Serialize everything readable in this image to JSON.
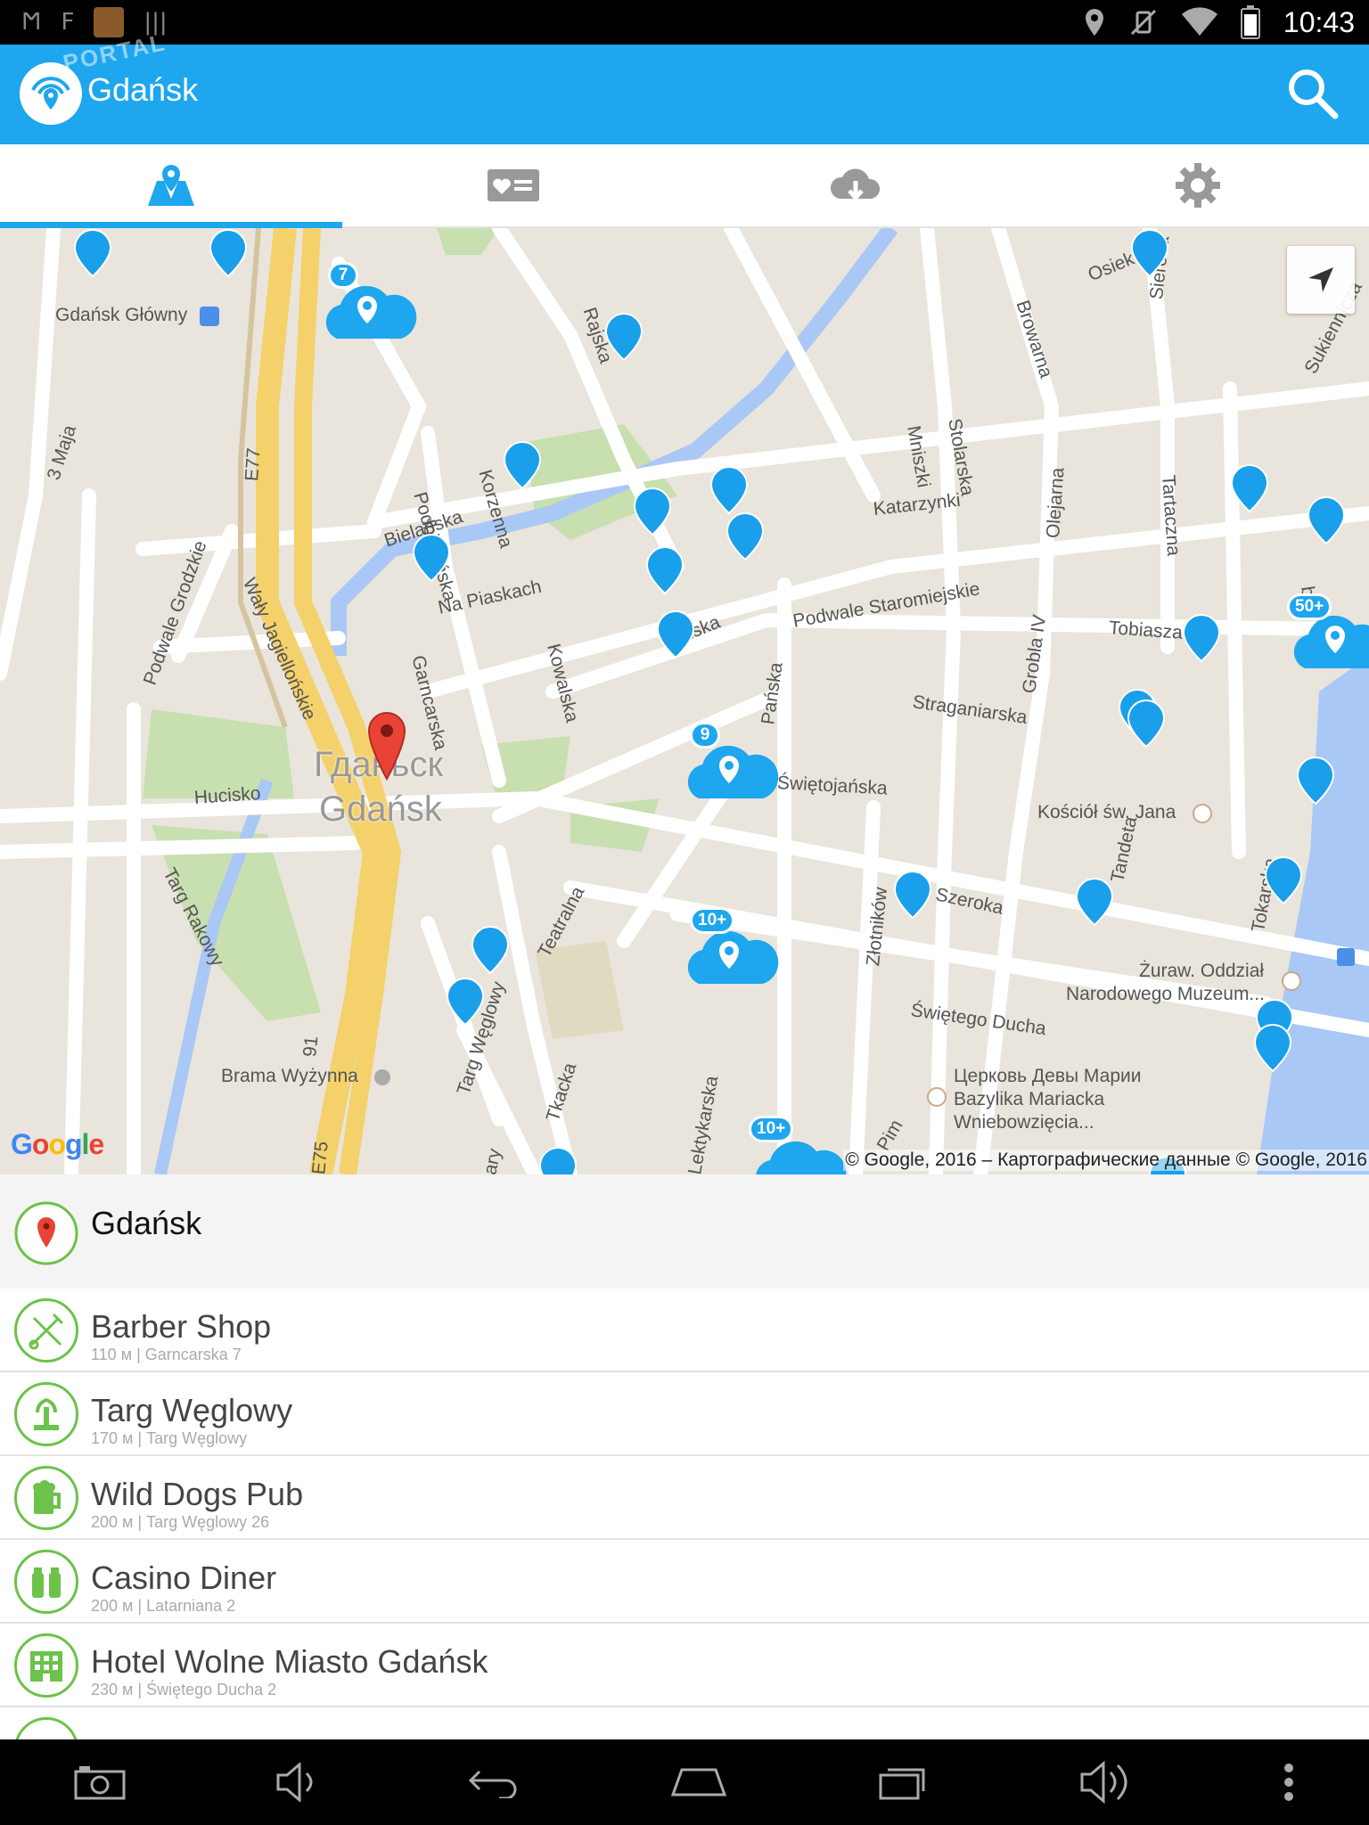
{
  "status_bar": {
    "time": "10:43",
    "left_icons": [
      "notification-m",
      "notification-f",
      "game-thumbnail",
      "barcode"
    ],
    "right_icons": [
      "location-icon",
      "vibrate-icon",
      "wifi-icon",
      "battery-icon"
    ]
  },
  "app_bar": {
    "title": "Gdańsk",
    "watermark": "PORTAL",
    "logo_icon": "wifi-pin-logo",
    "action_icon": "search-icon",
    "color": "#1ea6ee"
  },
  "tabs": [
    {
      "icon": "map-icon",
      "active": true
    },
    {
      "icon": "favorites-card-icon",
      "active": false
    },
    {
      "icon": "cloud-download-icon",
      "active": false
    },
    {
      "icon": "settings-gear-icon",
      "active": false
    }
  ],
  "map": {
    "city_label_ru": "Гданьск",
    "city_label_pl": "Gdańsk",
    "streets": {
      "gdansk_glowny": "Gdańsk Główny",
      "maja": "3 Maja",
      "podbielanska": "Podbielańska",
      "korzenna": "Korzenna",
      "bielanska": "Bielańska",
      "na_piaskach": "Na Piaskach",
      "garncarska": "Garncarska",
      "kowalska": "Kowalska",
      "podwale_grodzkie": "Podwale Grodzkie",
      "waly_jagiellonskie": "Wały Jagiellońskie",
      "hucisko": "Hucisko",
      "targ_rakowy": "Targ Rakowy",
      "teatralna": "Teatralna",
      "targ_weglowy": "Targ Węglowy",
      "tkacka": "Tkacka",
      "brama": "Brama Wyżynna",
      "lektykarska": "Lektykarska",
      "panska": "Pańska",
      "swietojanska": "Świętojańska",
      "ynska": "łyńska",
      "podwale_staromiejskie": "Podwale Staromiejskie",
      "katarzynki": "Katarzynki",
      "mniszki": "Mniszki",
      "stolarska": "Stolarska",
      "olejarna": "Olejarna",
      "grobla": "Grobla IV",
      "tartaczna": "Tartaczna",
      "browarna": "Browarna",
      "sieroca": "Sieroca",
      "osiek": "Osiek",
      "rajska": "Rajska",
      "tobiasza": "Tobiasza",
      "straganiarska": "Straganiarska",
      "kosciol": "Kościół św. Jana",
      "szeroka": "Szeroka",
      "zlotnikow": "Złotników",
      "tandeta": "Tandeta",
      "tokarska": "Tokarska",
      "zuraw1": "Żuraw. Oddział",
      "zuraw2": "Narodowego Muzeum...",
      "swietego_ducha": "Świętego Ducha",
      "cerkov": "Церковь Девы Марии",
      "bazylika": "Bazylika Mariacka",
      "wniebowziecia": "Wniebowzięcia...",
      "sukiennicza": "Sukiennicza",
      "e77": "E77",
      "e75": "E75",
      "r91": "91",
      "ary": "ary",
      "pim": "Pim",
      "bny": "bny"
    },
    "clusters": [
      "7",
      "9",
      "10+",
      "10+",
      "50+"
    ],
    "google_logo": "Google",
    "attribution": "© Google, 2016 – Картографические данные © Google, 2016",
    "locate_icon": "navigation-arrow-icon",
    "accent_color": "#1a9fea"
  },
  "current_location": {
    "title": "Gdańsk",
    "icon": "red-location-pin-icon"
  },
  "places": [
    {
      "name": "Barber Shop",
      "meta": "110 м | Garncarska 7",
      "icon": "barber-scissors-comb-icon"
    },
    {
      "name": "Targ Węglowy",
      "meta": "170 м | Targ Węglowy",
      "icon": "fountain-icon"
    },
    {
      "name": "Wild Dogs Pub",
      "meta": "200 м | Targ Węglowy 26",
      "icon": "beer-mug-icon"
    },
    {
      "name": "Casino Diner",
      "meta": "200 м | Latarniana 2",
      "icon": "salt-pepper-icon"
    },
    {
      "name": "Hotel Wolne Miasto Gdańsk",
      "meta": "230 м | Świętego Ducha 2",
      "icon": "hotel-building-icon"
    }
  ],
  "nav_bar": [
    "camera-icon",
    "volume-down-icon",
    "back-icon",
    "home-icon",
    "recents-icon",
    "volume-up-icon",
    "more-icon"
  ]
}
